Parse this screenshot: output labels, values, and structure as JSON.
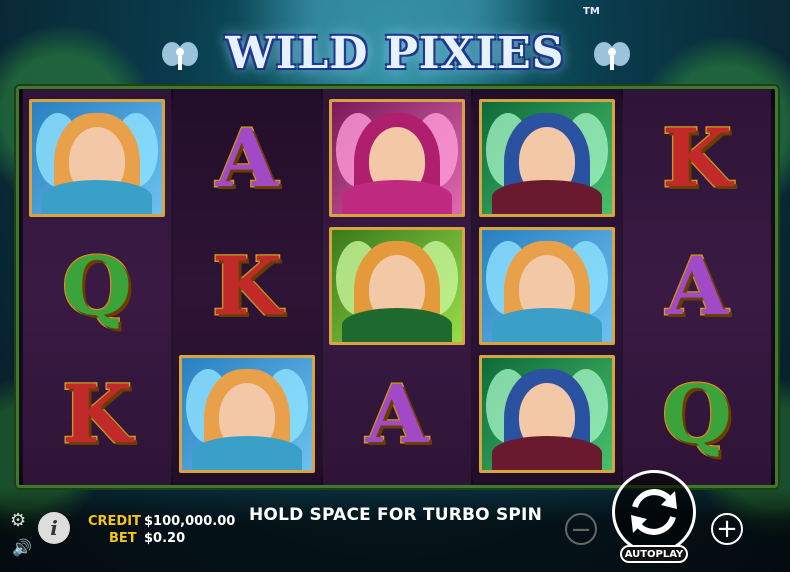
{
  "game": {
    "logo": "WILD PIXIES",
    "trademark": "TM"
  },
  "reels": [
    [
      "fairy-blonde",
      "Q",
      "K"
    ],
    [
      "A",
      "K",
      "fairy-blonde"
    ],
    [
      "fairy-pink",
      "elf-green",
      "A"
    ],
    [
      "elf-prince",
      "fairy-blonde",
      "elf-prince"
    ],
    [
      "K",
      "A",
      "Q"
    ]
  ],
  "hud": {
    "credit_label": "CREDIT",
    "credit_value": "$100,000.00",
    "bet_label": "BET",
    "bet_value": "$0.20",
    "message": "HOLD SPACE FOR TURBO SPIN",
    "minus_label": "−",
    "plus_label": "+",
    "autoplay_label": "AUTOPLAY",
    "info_label": "i"
  },
  "icons": [
    "gear-icon",
    "sound-icon",
    "info-icon",
    "spin-icon"
  ],
  "colors": {
    "credit_label": "#f5c518",
    "frame_gold": "#d6a540",
    "letter_A": "#a04ac8",
    "letter_K": "#c22a2a",
    "letter_Q": "#3aa43a"
  }
}
